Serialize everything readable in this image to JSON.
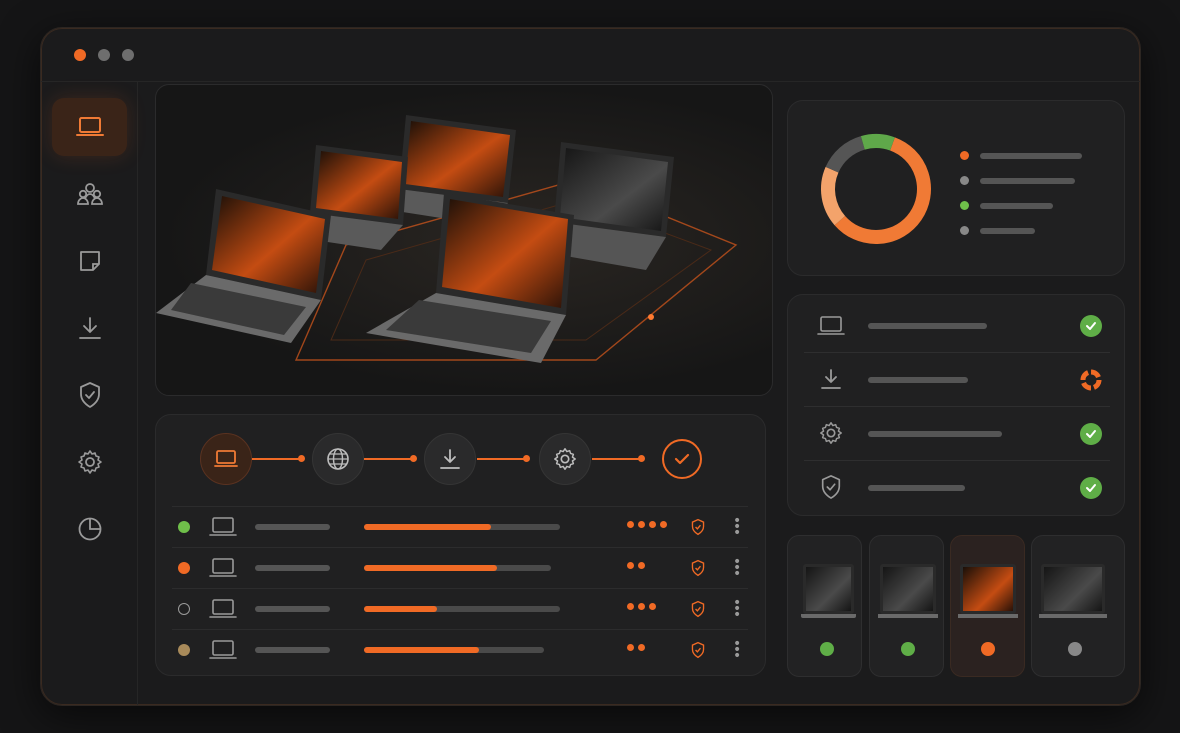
{
  "window": {
    "controls": [
      {
        "name": "close",
        "color": "#f06a25"
      },
      {
        "name": "minimize",
        "color": "#777777"
      },
      {
        "name": "maximize",
        "color": "#777777"
      }
    ]
  },
  "sidebar": {
    "items": [
      {
        "icon": "laptop-icon",
        "active": true
      },
      {
        "icon": "users-icon",
        "active": false
      },
      {
        "icon": "window-icon",
        "active": false
      },
      {
        "icon": "download-icon",
        "active": false
      },
      {
        "icon": "shield-icon",
        "active": false
      },
      {
        "icon": "gear-icon",
        "active": false
      },
      {
        "icon": "pie-chart-icon",
        "active": false
      }
    ]
  },
  "hero": {
    "image": "laptops-fleet-illustration",
    "laptop_count": 5
  },
  "pipeline": {
    "steps": [
      "laptop-icon",
      "globe-icon",
      "download-icon",
      "gear-icon",
      "check-icon"
    ],
    "active_step": 0,
    "complete_step": 4
  },
  "devices": [
    {
      "status_color": "#6fbf4a",
      "progress": 0.65,
      "dots": 4
    },
    {
      "status_color": "#f06a25",
      "progress": 0.71,
      "dots": 2
    },
    {
      "status_color": "hollow",
      "progress": 0.37,
      "dots": 3
    },
    {
      "status_color": "#a88a5a",
      "progress": 0.64,
      "dots": 2
    }
  ],
  "donut": {
    "segments": [
      {
        "color": "#f07a35",
        "value": 0.58
      },
      {
        "color": "#f3a36b",
        "value": 0.18
      },
      {
        "color": "#555555",
        "value": 0.14
      },
      {
        "color": "#5fa84a",
        "value": 0.1
      }
    ],
    "legend_colors": [
      "#f06a25",
      "#888888",
      "#6fbf4a",
      "#888888"
    ]
  },
  "status_list": [
    {
      "icon": "laptop-icon",
      "state": "ok"
    },
    {
      "icon": "download-icon",
      "state": "pending"
    },
    {
      "icon": "gear-icon",
      "state": "ok"
    },
    {
      "icon": "shield-icon",
      "state": "ok"
    }
  ],
  "thumbnails": [
    {
      "screen": "gray",
      "status_color": "#5fae47",
      "selected": false
    },
    {
      "screen": "gray",
      "status_color": "#5fae47",
      "selected": false
    },
    {
      "screen": "orange",
      "status_color": "#f06a25",
      "selected": true
    },
    {
      "screen": "gray",
      "status_color": "#888888",
      "selected": false
    }
  ]
}
